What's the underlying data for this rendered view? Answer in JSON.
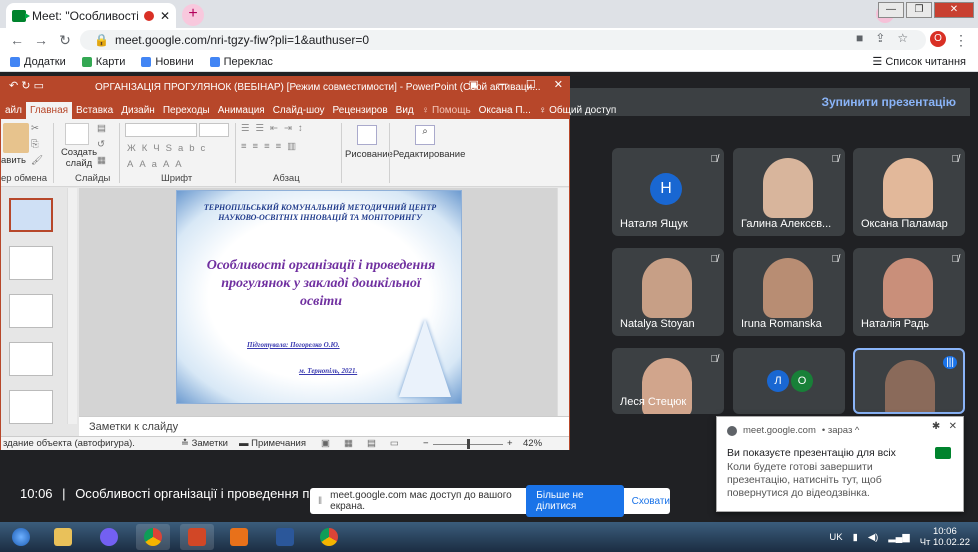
{
  "browser": {
    "tab_title": "Meet: \"Особливості органі",
    "new_tab": "+",
    "url": "meet.google.com/nri-tgzy-fiw?pli=1&authuser=0",
    "profile_letter": "O",
    "bookmarks": [
      {
        "label": "Додатки",
        "color": "#4285f4"
      },
      {
        "label": "Карти",
        "color": "#34a853"
      },
      {
        "label": "Новини",
        "color": "#4285f4"
      },
      {
        "label": "Переклас",
        "color": "#4285f4"
      }
    ],
    "reading_list": "Список читання"
  },
  "meet": {
    "stop_presenting": "Зупинити презентацію",
    "participants": [
      {
        "name": "Наталя Ящук",
        "avatar_letter": "H",
        "avatar_color": "#1967d2"
      },
      {
        "name": "Галина Алексєв...",
        "skin": "#d8b59c"
      },
      {
        "name": "Оксана Паламар",
        "skin": "#e2b89a"
      },
      {
        "name": "Natalya Stoyan",
        "skin": "#c79f86"
      },
      {
        "name": "Iruna Romanska",
        "skin": "#b88d73"
      },
      {
        "name": "Наталія Радь",
        "skin": "#c98f7a"
      },
      {
        "name": "Леся Стецюк",
        "skin": "#d1a58c"
      },
      {
        "name": "",
        "avatar_letters": [
          "Л",
          "О"
        ],
        "avatar_colors": [
          "#1967d2",
          "#188038"
        ]
      },
      {
        "name": "",
        "skin": "#8a6a5a"
      }
    ],
    "time": "10:06",
    "separator": "|",
    "meeting_title": "Особливості організації і проведення прог...",
    "share_notice": {
      "text": "meet.google.com має доступ до вашого екрана.",
      "stop_label": "Більше не ділитися",
      "hide_label": "Сховати"
    },
    "notification": {
      "source": "meet.google.com",
      "when": "• зараз ^",
      "title": "Ви показуєте презентацію для всіх",
      "body": "Коли будете готові завершити презентацію, натисніть тут, щоб повернутися до відеодзвінка."
    }
  },
  "ppt": {
    "title": "ОРГАНІЗАЦІЯ ПРОГУЛЯНОК (ВЕБІНАР) [Режим совместимости] - PowerPoint (Сбой активаци...",
    "tabs": [
      "айл",
      "Главная",
      "Вставка",
      "Дизайн",
      "Переходы",
      "Анимация",
      "Слайд-шоу",
      "Рецензиров",
      "Вид",
      "♀ Помощь",
      "Оксана П...",
      "♀ Общий доступ"
    ],
    "groups": {
      "clipboard": "ер обмена",
      "paste": "авить",
      "slides": "Слайды",
      "create_slide": "Создать\nслайд",
      "font": "Шрифт",
      "paragraph": "Абзац",
      "drawing": "Рисование",
      "editing": "Редактирование"
    },
    "slide": {
      "org": "ТЕРНОПІЛЬСЬКИЙ КОМУНАЛЬНИЙ МЕТОДИЧНИЙ ЦЕНТР НАУКОВО-ОСВІТНІХ ІННОВАЦІЙ ТА МОНІТОРИНГУ",
      "title": "Особливості організації і проведення прогулянок у закладі дошкільної освіти",
      "author": "Підготувала: Погорелко О.Ю.",
      "city": "м. Тернопіль, 2021."
    },
    "notes_placeholder": "Заметки к слайду",
    "status_left": "здание объекта (автофигура).",
    "status_notes": "Заметки",
    "status_comments": "Примечания",
    "zoom": "42%"
  },
  "taskbar": {
    "lang": "UK",
    "time": "10:06",
    "date": "Чт 10.02.22"
  }
}
